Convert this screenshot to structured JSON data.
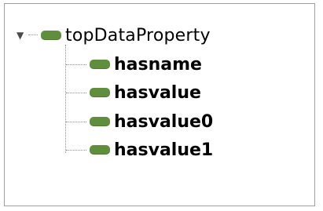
{
  "tree": {
    "root": {
      "label": "topDataProperty",
      "expander_icon": "triangle-down-icon",
      "icon": "data-property-icon",
      "icon_color": "#5f8f3d",
      "expanded": true
    },
    "children": [
      {
        "label": "hasname",
        "icon": "data-property-icon",
        "icon_color": "#5f8f3d"
      },
      {
        "label": "hasvalue",
        "icon": "data-property-icon",
        "icon_color": "#5f8f3d"
      },
      {
        "label": "hasvalue0",
        "icon": "data-property-icon",
        "icon_color": "#5f8f3d"
      },
      {
        "label": "hasvalue1",
        "icon": "data-property-icon",
        "icon_color": "#5f8f3d"
      }
    ]
  }
}
